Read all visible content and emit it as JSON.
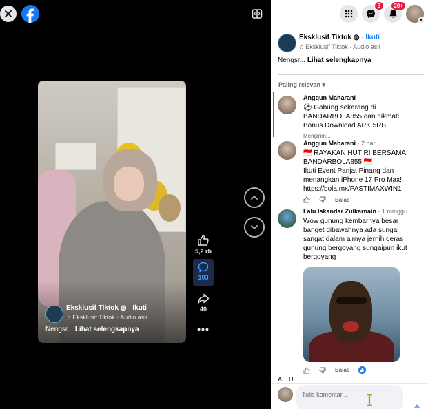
{
  "viewer": {
    "close_icon": "close-icon",
    "logo_icon": "facebook-logo-icon",
    "collapse_icon": "collapse-panel-icon",
    "reel": {
      "author": "Eksklusif Tiktok",
      "follow": "Ikuti",
      "audio": "Eksklusif Tiktok · Audio asli",
      "caption": "Nengsr...",
      "see_more": "Lihat selengkapnya"
    },
    "actions": {
      "like_count": "5,2 rb",
      "comment_count": "103",
      "share_count": "40"
    }
  },
  "topbar": {
    "messenger_badge": "3",
    "notifications_badge": "20+"
  },
  "post": {
    "author": "Eksklusif Tiktok",
    "follow": "Ikuti",
    "audio": "Eksklusif Tiktok · Audio asli",
    "caption": "Nengsr...",
    "see_more": "Lihat selengkapnya"
  },
  "sort_label": "Paling relevan",
  "comments": [
    {
      "name": "Anggun Maharani",
      "time": "",
      "text": "⚽ Gabung sekarang di BANDARBOLA855 dan nikmati Bonus Download APK 5RB!",
      "status": "Mengirim..."
    },
    {
      "name": "Anggun Maharani",
      "time": "· 2 hari",
      "text": "🇮🇩 RAYAKAN HUT RI BERSAMA BANDARBOLA855 🇮🇩",
      "text2": "Ikuti Event Panjat Pinang dan menangkan iPhone 17 Pro Max! https://bola.mx/PASTIMAXWIN1",
      "reply": "Balas"
    },
    {
      "name": "Lalu Iskandar Zulkarnain",
      "time": "· 1 minggu",
      "text": "Wow gunung kembarnya besar banget dibawahnya ada sungai sangat dalam airnya jernih deras gunung bergoyang sungaipun ikut bergoyang",
      "reply": "Balas"
    }
  ],
  "partial_comment": "A... U...",
  "comment_box": {
    "placeholder": "Tulis komentar..."
  }
}
